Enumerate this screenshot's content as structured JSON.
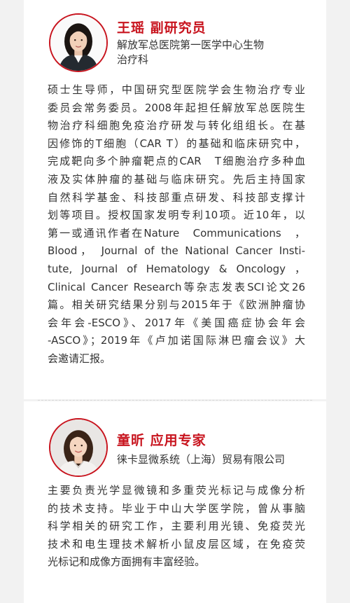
{
  "colors": {
    "accent": "#c8141e",
    "text": "#333333",
    "background": "#f2f2f2",
    "card": "#ffffff"
  },
  "profiles": [
    {
      "name": "王瑶 副研究员",
      "affiliation_lines": [
        "解放军总医院第一医学中心生物",
        "治疗科"
      ],
      "bio_lines": [
        "硕士生导师，中国研究型医院学会生物治疗专业",
        "委员会常务委员。2008年起担任解放军总医院生",
        "物治疗科细胞免疫治疗研发与转化组组长。在基",
        "因修饰的T细胞（CAR T）的基础和临床研究中，",
        "完成靶向多个肿瘤靶点的CAR　T细胞治疗多种血",
        "液及实体肿瘤的基础与临床研究。先后主持国家",
        "自然科学基金、科技部重点研发、科技部支撑计",
        "划等项目。授权国家发明专利10项。近10年，以",
        "第一或通讯作者在Nature　Communications　，",
        "Blood， Journal of the National Cancer Insti-",
        "tute, Journal of Hematology & Oncology ，",
        "Clinical Cancer Research等杂志发表SCI论文26",
        "篇。相关研究结果分别与2015年于《欧洲肿瘤协",
        "会年会-ESCO》、2017年《美国癌症协会年会",
        "-ASCO》；2019年《卢加诺国际淋巴瘤会议》大",
        "会邀请汇报。"
      ]
    },
    {
      "name": "童昕 应用专家",
      "affiliation_lines": [
        "徕卡显微系统（上海）贸易有限公司"
      ],
      "bio_lines": [
        "主要负责光学显微镜和多重荧光标记与成像分析",
        "的技术支持。毕业于中山大学医学院，曾从事脑",
        "科学相关的研究工作，主要利用光镜、免疫荧光",
        "技术和电生理技术解析小鼠皮层区域，在免疫荧",
        "光标记和成像方面拥有丰富经验。"
      ]
    }
  ]
}
